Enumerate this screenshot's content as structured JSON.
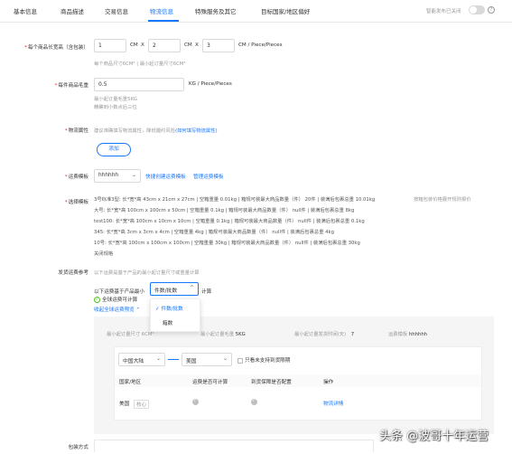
{
  "tabs": [
    "基本信息",
    "商品描述",
    "交易信息",
    "物流信息",
    "特殊服务及其它",
    "目标国家/地区偏好"
  ],
  "active_tab": "物流信息",
  "header": {
    "toggle_label": "智能发布已关闭",
    "help": "?"
  },
  "package_size": {
    "label": "每个商品长宽高（含包装）",
    "length": "1",
    "width": "2",
    "height": "3",
    "unit": "CM",
    "sep": "X",
    "suffix": "CM  / Piece/Pieces",
    "hint": "每个商品尺寸6CM³ | 最小起订量尺寸6CM³"
  },
  "gross_weight": {
    "label": "每件商品毛重",
    "value": "0.5",
    "unit": "KG / Piece/Pieces",
    "hint1": "最小起订量毛重5KG",
    "hint2": "精确到小数点后三位"
  },
  "logistics_attr": {
    "label": "物流属性",
    "desc": "建议准确填写物流属性，降低履约风险",
    "link": "(如何填写物流属性)",
    "add_button": "添加"
  },
  "shipping_template": {
    "label": "运费模板",
    "selected": "hhhhhh",
    "create_link": "快捷创建运费模板",
    "manage_link": "管理运费模板"
  },
  "template_detail": {
    "label": "选择模板",
    "lines": [
      "3号标准3型: 长*宽*高 43cm x 21cm x 27cm | 空箱重量 0.01kg | 箱规可装最大商品数量（件） 20件 | 装满后包裹总重 10.01kg",
      "大号: 长*宽*高 100cm x 100cm x 50cm | 空箱重量 0.1kg | 箱规可装最大商品数量（件） null件 | 装满后包裹总重 8kg",
      "test100: 长*宽*高 100cm x 10cm x 10cm | 空箱重量 0.1kg | 箱规可装最大商品数量（件） null件 | 装满后包裹总重 0.1kg",
      "345: 长*宽*高 3cm x 3cm x 4cm | 空箱重量 4kg | 箱规可装最大商品数量（件） null件 | 装满后包裹总重 4kg",
      "10号: 长*宽*高 100cm x 100cm x 100cm | 空箱重量 30kg | 箱规可装最大商品数量（件） null件 | 装满后包裹总重 30kg"
    ],
    "extra_link": "按箱包装价格展开规则报价",
    "close_link": "关闭规格"
  },
  "shipping_ref": {
    "label": "发货运费参考",
    "desc": "以下运费是基于产品的最小起订量尺寸或重量计算",
    "calc_prefix": "以下运费基于产品最小",
    "calc_selected": "件数/批数",
    "calc_suffix": "计算",
    "status": "全球运费可计算",
    "preview_link": "收起全球运费预览",
    "dropdown_options": [
      "件数/批数",
      "箱数"
    ]
  },
  "summary": {
    "min_size_label": "最小起订量尺寸",
    "min_size_value": "6CM³",
    "min_weight_label": "最小起订量毛重",
    "min_weight_value": "5KG",
    "min_days_label": "最小起订量发货时间(天)",
    "min_days_value": "7",
    "template_label": "运费模板",
    "template_value": "hhhhhh"
  },
  "route": {
    "from": "中国大陆",
    "to": "美国",
    "only_label": "只看未支持到货限期"
  },
  "table": {
    "headers": [
      "国家/地区",
      "运费是否可计算",
      "到货保障是否配置",
      "操作"
    ],
    "row": {
      "country": "美国",
      "tag": "核心",
      "action": "物流详情"
    }
  },
  "packaging": {
    "label": "包装方式"
  },
  "watermark": "头条 @波哥十年运营"
}
